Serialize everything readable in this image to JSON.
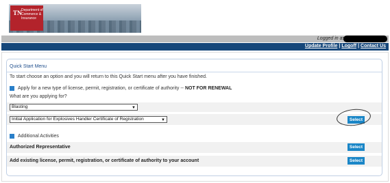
{
  "banner": {
    "logo_mark": "TN",
    "logo_text": "Department of Commerce & Insurance"
  },
  "session": {
    "logged_in_label": "Logged in as"
  },
  "top_links": {
    "update_profile": "Update Profile",
    "logoff": "Logoff",
    "contact_us": "Contact Us",
    "separator": "|"
  },
  "quick_start": {
    "title": "Quick Start Menu",
    "intro": "To start choose an option and you will return to this Quick Start menu after you have finished.",
    "apply_section": {
      "label": "Apply for a new type of license, permit, registration, or certificate of authority -- ",
      "label_emphasis": "NOT FOR RENEWAL",
      "question": "What are you applying for?",
      "category_select_value": "Blasting",
      "application_select_value": "Initial Application for Explosives Handler Certificate of Registration",
      "select_button": "Select"
    },
    "additional_activities": {
      "label": "Additional Activities",
      "items": [
        {
          "label": "Authorized Representative",
          "button": "Select"
        },
        {
          "label": "Add existing license, permit, registration, or certificate of authority to your account",
          "button": "Select"
        }
      ]
    }
  },
  "colors": {
    "nav_bar": "#16477a",
    "accent_button": "#1a86c7",
    "section_square": "#2a7fc9",
    "title_blue": "#1f4e8c",
    "logo_red": "#b3232b"
  },
  "icons": [
    "section-square-icon",
    "dropdown-arrow-icon"
  ]
}
